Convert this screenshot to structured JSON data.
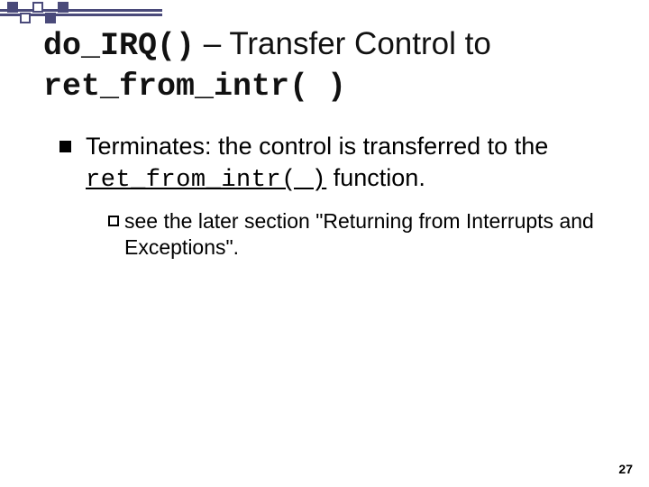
{
  "title": {
    "code1": "do_IRQ()",
    "mid": " – Transfer Control to ",
    "code2": "ret_from_intr( )"
  },
  "bullet1": {
    "pre": "Terminates: the control is transferred to the ",
    "code": "ret_from_intr( )",
    "post": " function."
  },
  "bullet2": {
    "text": "see the later section \"Returning from Interrupts and Exceptions\"."
  },
  "page_number": "27"
}
